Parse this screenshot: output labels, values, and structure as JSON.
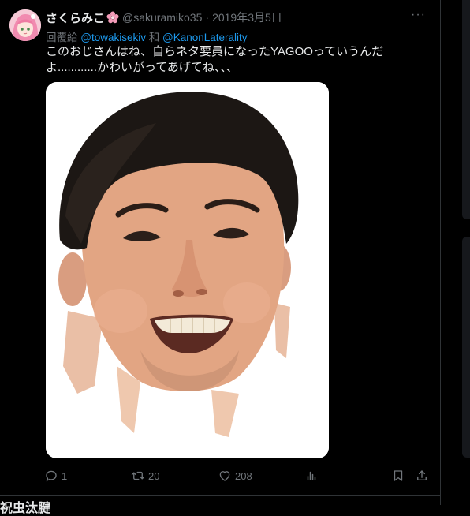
{
  "tweet": {
    "author_name": "さくらみこ",
    "handle": "@sakuramiko35",
    "separator": "·",
    "date": "2019年3月5日",
    "reply_prefix": "回覆給",
    "reply_user1": "@towakisekiv",
    "reply_and": "和",
    "reply_user2": "@KanonLaterality",
    "text": "このおじさんはね、自らネタ要員になったYAGOOっていうんだよ............かわいがってあげてね、、、",
    "more_label": "···",
    "image_alt": "smiling man face cutout photo"
  },
  "actions": {
    "replies": "1",
    "retweets": "20",
    "likes": "208"
  },
  "icons": {
    "reply": "reply-icon",
    "retweet": "retweet-icon",
    "like": "heart-icon",
    "views": "analytics-icon",
    "bookmark": "bookmark-icon",
    "share": "share-icon"
  },
  "colors": {
    "background": "#000000",
    "text": "#e7e9ea",
    "muted": "#71767b",
    "link": "#1d9bf0"
  },
  "next": {
    "partial_text": "祝虫汰腱"
  }
}
